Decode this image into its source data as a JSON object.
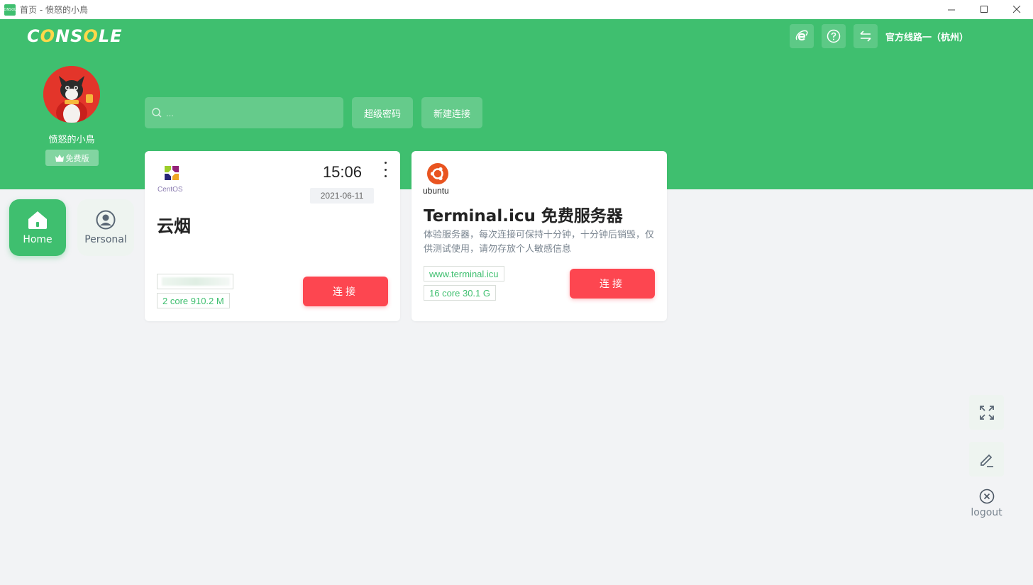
{
  "window": {
    "title": "首页 - 愤怒的小鳥",
    "app_icon_text": "CONSOLE"
  },
  "header": {
    "logo": {
      "part1": "C",
      "o1": "O",
      "part2": "NS",
      "o2": "O",
      "part3": "LE"
    },
    "server_line": "官方线路一（杭州）",
    "icons": [
      "ie-icon",
      "help-icon",
      "switch-icon"
    ]
  },
  "profile": {
    "username": "愤怒的小鳥",
    "plan_badge": "免费版"
  },
  "search": {
    "placeholder": "..."
  },
  "actions": {
    "super_password": "超级密码",
    "new_connection": "新建连接"
  },
  "nav": {
    "home": "Home",
    "personal": "Personal"
  },
  "cards": [
    {
      "os": "CentOS",
      "title": "云烟",
      "time": "15:06",
      "date": "2021-06-11",
      "host": "",
      "specs": "2 core 910.2 M",
      "connect": "连接"
    },
    {
      "os": "ubuntu",
      "title": "Terminal.icu 免费服务器",
      "description": "体验服务器，每次连接可保持十分钟，十分钟后销毁，仅供测试使用，请勿存放个人敏感信息",
      "host": "www.terminal.icu",
      "specs": "16 core 30.1 G",
      "connect": "连接"
    }
  ],
  "floating": {
    "logout": "logout"
  },
  "colors": {
    "brand_green": "#3fbf6f",
    "connect_red": "#fd4650",
    "page_bg": "#f2f3f5"
  }
}
